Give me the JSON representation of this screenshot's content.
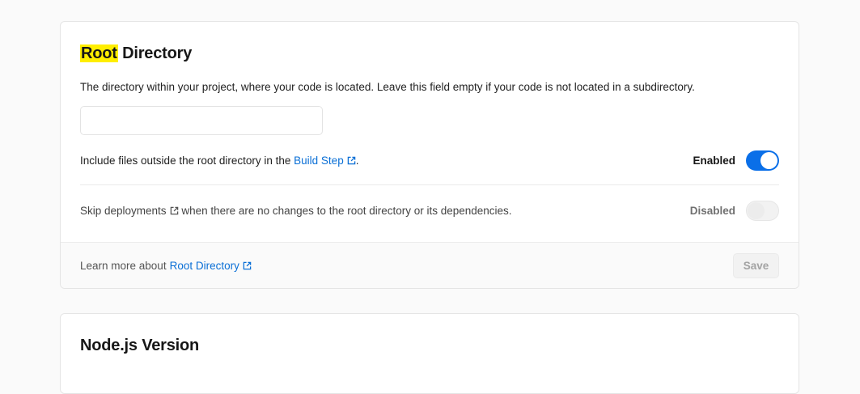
{
  "root_directory": {
    "title_highlight": "Root",
    "title_rest": " Directory",
    "description": "The directory within your project, where your code is located. Leave this field empty if your code is not located in a subdirectory.",
    "input": {
      "value": "",
      "placeholder": ""
    },
    "include_files": {
      "text_before": "Include files outside the root directory in the ",
      "link_text": "Build Step",
      "text_after": ".",
      "status": "Enabled",
      "enabled": true
    },
    "skip_deployments": {
      "link_text": "Skip deployments",
      "text_after": " when there are no changes to the root directory or its dependencies.",
      "status": "Disabled",
      "enabled": false
    },
    "footer": {
      "learn_more_text": "Learn more about",
      "link_text": "Root Directory",
      "save_label": "Save"
    }
  },
  "nodejs_version": {
    "title": "Node.js Version"
  },
  "colors": {
    "link": "#0a6fd6",
    "toggle_on": "#0a6fe8",
    "highlight": "#ffee00"
  }
}
